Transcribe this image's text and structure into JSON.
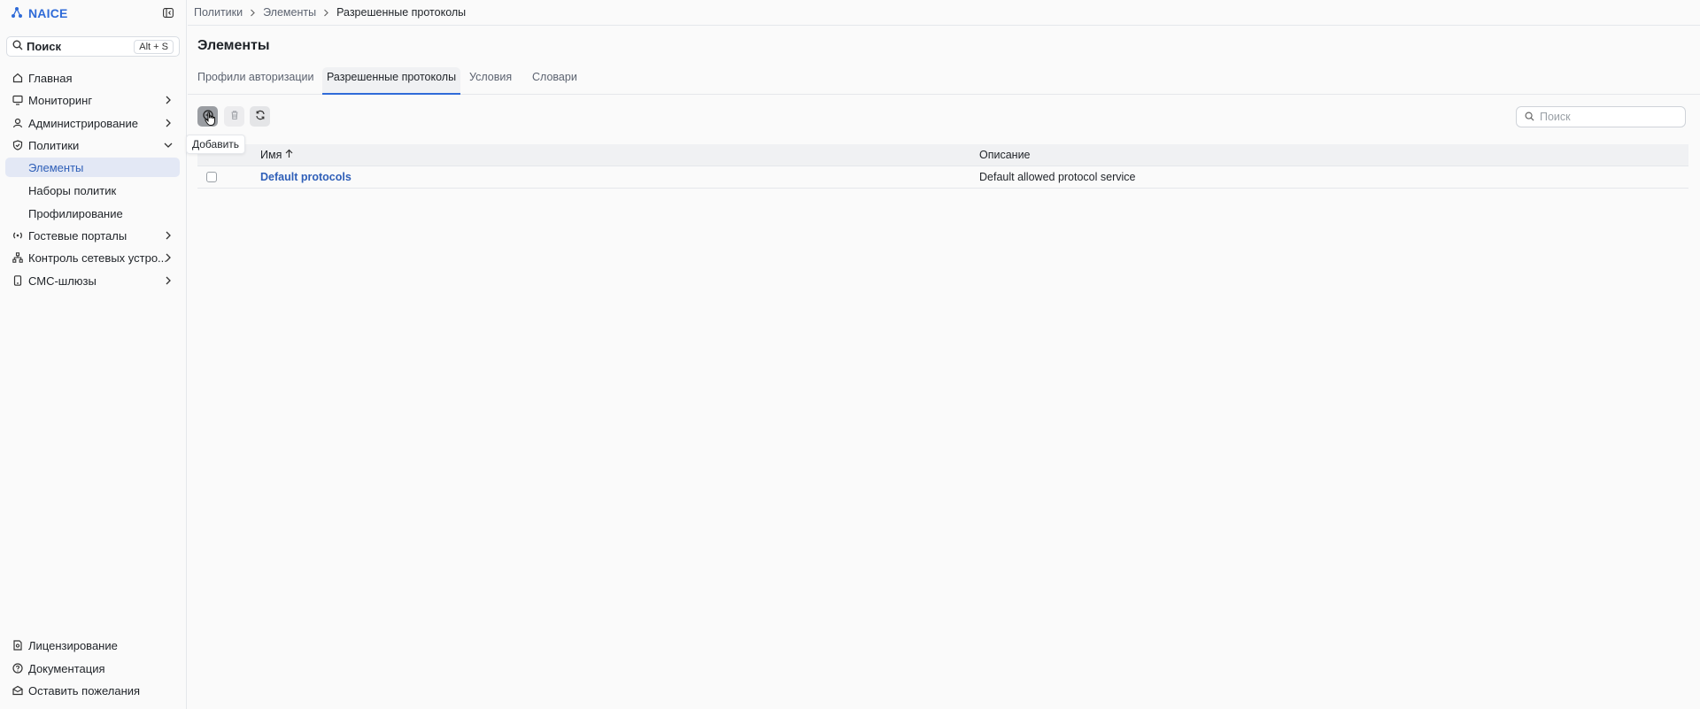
{
  "app": {
    "name": "NAICE"
  },
  "search": {
    "label": "Поиск",
    "shortcut": "Alt + S"
  },
  "nav": {
    "items": [
      {
        "label": "Главная",
        "icon": "home-icon"
      },
      {
        "label": "Мониторинг",
        "icon": "monitor-icon"
      },
      {
        "label": "Администрирование",
        "icon": "user-icon"
      },
      {
        "label": "Политики",
        "icon": "shield-icon"
      },
      {
        "label": "Гостевые порталы",
        "icon": "wifi-icon"
      },
      {
        "label": "Контроль сетевых устро...",
        "icon": "network-icon"
      },
      {
        "label": "СМС-шлюзы",
        "icon": "phone-icon"
      }
    ],
    "policies_sub": [
      {
        "label": "Элементы"
      },
      {
        "label": "Наборы политик"
      },
      {
        "label": "Профилирование"
      }
    ],
    "bottom": [
      {
        "label": "Лицензирование",
        "icon": "license-icon"
      },
      {
        "label": "Документация",
        "icon": "help-icon"
      },
      {
        "label": "Оставить пожелания",
        "icon": "mail-icon"
      }
    ]
  },
  "breadcrumb": [
    "Политики",
    "Элементы",
    "Разрешенные протоколы"
  ],
  "page": {
    "title": "Элементы"
  },
  "tabs": [
    {
      "label": "Профили авторизации"
    },
    {
      "label": "Разрешенные протоколы",
      "active": true
    },
    {
      "label": "Условия"
    },
    {
      "label": "Словари"
    }
  ],
  "toolbar": {
    "add_tooltip": "Добавить"
  },
  "table_search": {
    "placeholder": "Поиск"
  },
  "table": {
    "columns": [
      "Имя",
      "Описание"
    ],
    "rows": [
      {
        "name": "Default protocols",
        "description": "Default allowed protocol service"
      }
    ]
  },
  "colors": {
    "accent": "#2f6bd8",
    "active_bg": "#e3e8f5"
  }
}
